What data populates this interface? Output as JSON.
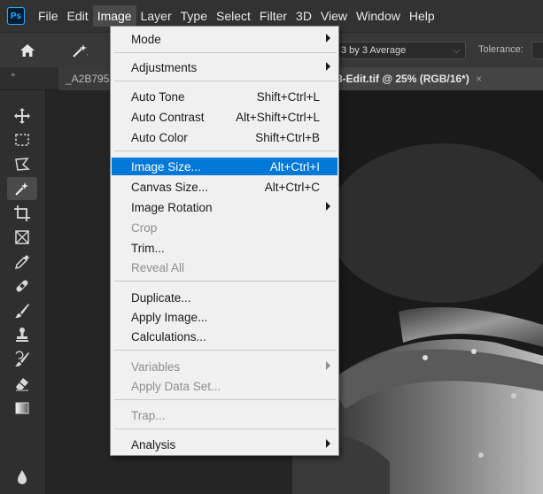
{
  "app": {
    "logo": "Ps"
  },
  "menubar": {
    "items": [
      {
        "label": "File"
      },
      {
        "label": "Edit"
      },
      {
        "label": "Image"
      },
      {
        "label": "Layer"
      },
      {
        "label": "Type"
      },
      {
        "label": "Select"
      },
      {
        "label": "Filter"
      },
      {
        "label": "3D"
      },
      {
        "label": "View"
      },
      {
        "label": "Window"
      },
      {
        "label": "Help"
      }
    ]
  },
  "options": {
    "sample_size": "3 by 3 Average",
    "tolerance_label": "Tolerance:"
  },
  "tabs": {
    "left_doc": "_A2B795",
    "active_doc": "3-Edit.tif @ 25% (RGB/16*)",
    "close_glyph": "×",
    "collapse_glyph": "»"
  },
  "image_menu": {
    "mode": {
      "label": "Mode"
    },
    "adjustments": {
      "label": "Adjustments"
    },
    "auto_tone": {
      "label": "Auto Tone",
      "shortcut": "Shift+Ctrl+L"
    },
    "auto_contrast": {
      "label": "Auto Contrast",
      "shortcut": "Alt+Shift+Ctrl+L"
    },
    "auto_color": {
      "label": "Auto Color",
      "shortcut": "Shift+Ctrl+B"
    },
    "image_size": {
      "label": "Image Size...",
      "shortcut": "Alt+Ctrl+I"
    },
    "canvas_size": {
      "label": "Canvas Size...",
      "shortcut": "Alt+Ctrl+C"
    },
    "image_rotation": {
      "label": "Image Rotation"
    },
    "crop": {
      "label": "Crop"
    },
    "trim": {
      "label": "Trim..."
    },
    "reveal_all": {
      "label": "Reveal All"
    },
    "duplicate": {
      "label": "Duplicate..."
    },
    "apply_image": {
      "label": "Apply Image..."
    },
    "calculations": {
      "label": "Calculations..."
    },
    "variables": {
      "label": "Variables"
    },
    "apply_data_set": {
      "label": "Apply Data Set..."
    },
    "trap": {
      "label": "Trap..."
    },
    "analysis": {
      "label": "Analysis"
    }
  },
  "colors": {
    "highlight": "#0078d7",
    "menu_bg": "#f0f0f0",
    "app_bg": "#323232"
  }
}
